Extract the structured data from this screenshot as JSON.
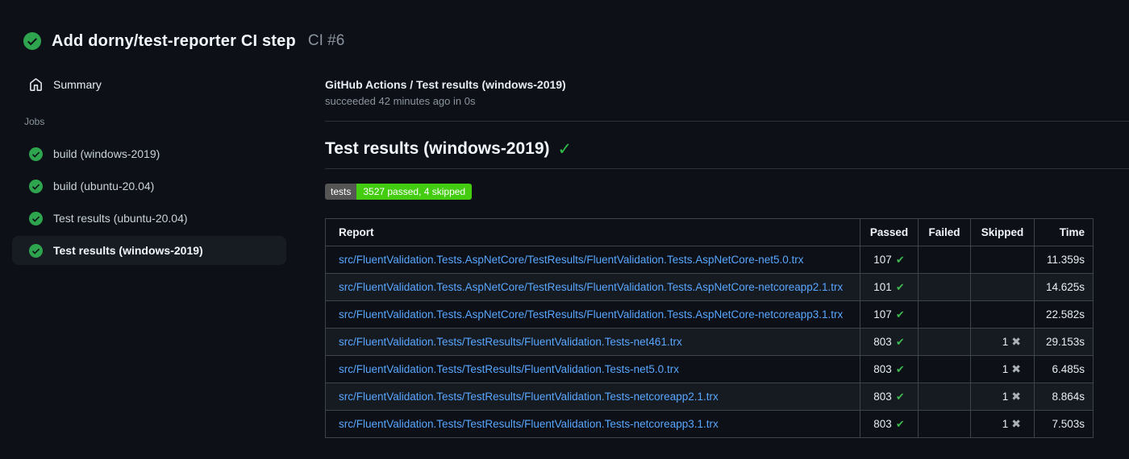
{
  "header": {
    "title": "Add dorny/test-reporter CI step",
    "run_number": "CI #6",
    "status": "success"
  },
  "sidebar": {
    "summary_label": "Summary",
    "jobs_heading": "Jobs",
    "jobs": [
      {
        "label": "build (windows-2019)",
        "status": "success",
        "selected": false
      },
      {
        "label": "build (ubuntu-20.04)",
        "status": "success",
        "selected": false
      },
      {
        "label": "Test results (ubuntu-20.04)",
        "status": "success",
        "selected": false
      },
      {
        "label": "Test results (windows-2019)",
        "status": "success",
        "selected": true
      }
    ]
  },
  "main": {
    "check_title": "GitHub Actions / Test results (windows-2019)",
    "check_subtitle": "succeeded 42 minutes ago in 0s",
    "section_title": "Test results (windows-2019)",
    "badge": {
      "label": "tests",
      "value": "3527 passed, 4 skipped"
    },
    "table": {
      "columns": [
        "Report",
        "Passed",
        "Failed",
        "Skipped",
        "Time"
      ],
      "rows": [
        {
          "report": "src/FluentValidation.Tests.AspNetCore/TestResults/FluentValidation.Tests.AspNetCore-net5.0.trx",
          "passed": "107",
          "failed": "",
          "skipped": "",
          "time": "11.359s"
        },
        {
          "report": "src/FluentValidation.Tests.AspNetCore/TestResults/FluentValidation.Tests.AspNetCore-netcoreapp2.1.trx",
          "passed": "101",
          "failed": "",
          "skipped": "",
          "time": "14.625s"
        },
        {
          "report": "src/FluentValidation.Tests.AspNetCore/TestResults/FluentValidation.Tests.AspNetCore-netcoreapp3.1.trx",
          "passed": "107",
          "failed": "",
          "skipped": "",
          "time": "22.582s"
        },
        {
          "report": "src/FluentValidation.Tests/TestResults/FluentValidation.Tests-net461.trx",
          "passed": "803",
          "failed": "",
          "skipped": "1",
          "time": "29.153s"
        },
        {
          "report": "src/FluentValidation.Tests/TestResults/FluentValidation.Tests-net5.0.trx",
          "passed": "803",
          "failed": "",
          "skipped": "1",
          "time": "6.485s"
        },
        {
          "report": "src/FluentValidation.Tests/TestResults/FluentValidation.Tests-netcoreapp2.1.trx",
          "passed": "803",
          "failed": "",
          "skipped": "1",
          "time": "8.864s"
        },
        {
          "report": "src/FluentValidation.Tests/TestResults/FluentValidation.Tests-netcoreapp3.1.trx",
          "passed": "803",
          "failed": "",
          "skipped": "1",
          "time": "7.503s"
        }
      ]
    }
  },
  "icons": {
    "header_status": "check-circle-icon",
    "summary": "home-icon",
    "job_status": "check-circle-icon",
    "passed_mark": "check-icon",
    "skipped_mark": "x-icon"
  },
  "colors": {
    "background": "#0d1117",
    "success_circle": "#2ea44f",
    "check_green": "#3fb950",
    "link_blue": "#58a6ff",
    "badge_label_bg": "#555555",
    "badge_value_bg": "#44cc11",
    "table_border": "#3d444d",
    "row_alt_bg": "#161b22",
    "muted_text": "#8b949e"
  }
}
